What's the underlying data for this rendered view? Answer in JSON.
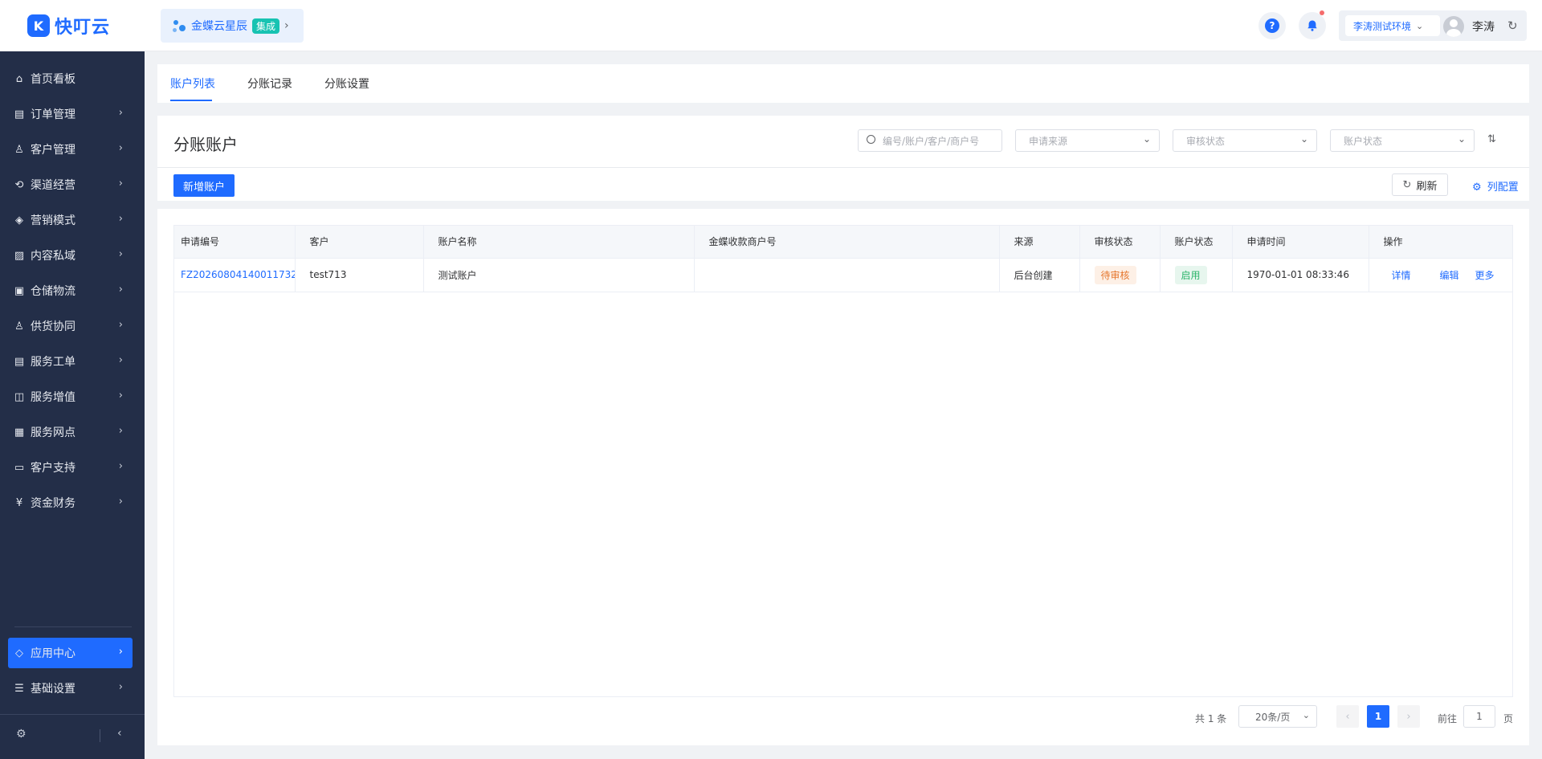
{
  "header": {
    "logo_text": "快叮云",
    "logo_mark": "K",
    "integration": {
      "name": "金蝶云星辰",
      "badge": "集成"
    },
    "help_glyph": "?",
    "env_select": "李涛测试环境",
    "user_name": "李涛"
  },
  "sidebar": {
    "items": [
      {
        "label": "首页看板",
        "icon": "home-icon",
        "glyph": "⌂"
      },
      {
        "label": "订单管理",
        "icon": "clipboard-icon",
        "glyph": "▤"
      },
      {
        "label": "客户管理",
        "icon": "user-icon",
        "glyph": "♙"
      },
      {
        "label": "渠道经营",
        "icon": "channel-icon",
        "glyph": "⟲"
      },
      {
        "label": "营销模式",
        "icon": "tag-icon",
        "glyph": "◈"
      },
      {
        "label": "内容私域",
        "icon": "image-icon",
        "glyph": "▨"
      },
      {
        "label": "仓储物流",
        "icon": "warehouse-icon",
        "glyph": "▣"
      },
      {
        "label": "供货协同",
        "icon": "supply-icon",
        "glyph": "♙"
      },
      {
        "label": "服务工单",
        "icon": "workorder-icon",
        "glyph": "▤"
      },
      {
        "label": "服务增值",
        "icon": "bag-icon",
        "glyph": "◫"
      },
      {
        "label": "服务网点",
        "icon": "store-icon",
        "glyph": "▦"
      },
      {
        "label": "客户支持",
        "icon": "support-icon",
        "glyph": "▭"
      },
      {
        "label": "资金财务",
        "icon": "yuan-icon",
        "glyph": "¥"
      }
    ],
    "bottom_items": [
      {
        "label": "应用中心",
        "icon": "cube-icon",
        "glyph": "◇",
        "active": true
      },
      {
        "label": "基础设置",
        "icon": "settings-list-icon",
        "glyph": "☰",
        "active": false
      }
    ]
  },
  "tabs": [
    {
      "label": "账户列表",
      "active": true
    },
    {
      "label": "分账记录",
      "active": false
    },
    {
      "label": "分账设置",
      "active": false
    }
  ],
  "toolbar": {
    "title": "分账账户",
    "search_placeholder": "编号/账户/客户/商户号",
    "source_placeholder": "申请来源",
    "audit_placeholder": "审核状态",
    "account_placeholder": "账户状态",
    "add_label": "新增账户",
    "refresh_label": "刷新",
    "column_config_label": "列配置"
  },
  "table": {
    "columns": [
      "申请编号",
      "客户",
      "账户名称",
      "金蝶收款商户号",
      "来源",
      "审核状态",
      "账户状态",
      "申请时间",
      "操作"
    ],
    "rows": [
      {
        "id": "FZ20260804140011732",
        "customer": "test713",
        "account_name": "测试账户",
        "merchant_no": "",
        "source": "后台创建",
        "audit_status": "待审核",
        "account_status": "启用",
        "apply_time": "1970-01-01 08:33:46",
        "actions": [
          "详情",
          "编辑",
          "更多"
        ]
      }
    ]
  },
  "pagination": {
    "total_text": "共 1 条",
    "page_size": "20条/页",
    "current_page": "1",
    "goto_label": "前往",
    "goto_value": "1",
    "page_suffix": "页"
  },
  "colors": {
    "primary": "#1f6bff",
    "sidebar_bg": "#232e48",
    "warn": "#e6772e",
    "success": "#2db56b"
  }
}
